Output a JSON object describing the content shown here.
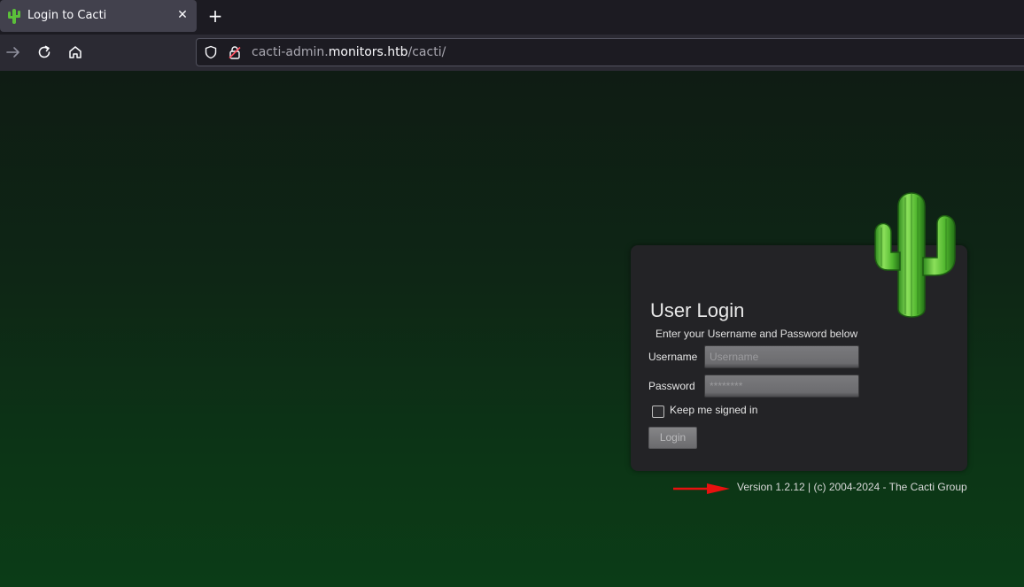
{
  "browser": {
    "tab": {
      "title": "Login to Cacti",
      "favicon": "cactus-icon",
      "close_icon": "close-icon"
    },
    "new_tab_icon": "plus-icon",
    "nav": {
      "forward_icon": "arrow-right-icon",
      "reload_icon": "reload-icon",
      "home_icon": "home-icon"
    },
    "url": {
      "shield_icon": "shield-icon",
      "lock_icon": "insecure-lock-icon",
      "prefix": "cacti-admin.",
      "host": "monitors.htb",
      "path": "/cacti/"
    }
  },
  "login": {
    "logo": "cactus-logo",
    "title": "User Login",
    "subtitle": "Enter your Username and Password below",
    "username_label": "Username",
    "username_placeholder": "Username",
    "username_value": "",
    "password_label": "Password",
    "password_placeholder": "********",
    "password_value": "",
    "keep_signed_in_label": "Keep me signed in",
    "keep_signed_in_checked": false,
    "login_button": "Login"
  },
  "footer": {
    "version_text": "Version 1.2.12 | (c) 2004-2024 - The Cacti Group",
    "annotation": "red-arrow"
  },
  "colors": {
    "panel_bg": "#232326",
    "arrow": "#e8110f",
    "page_gradient_top": "#0f1c14",
    "page_gradient_bottom": "#0b3c17"
  }
}
